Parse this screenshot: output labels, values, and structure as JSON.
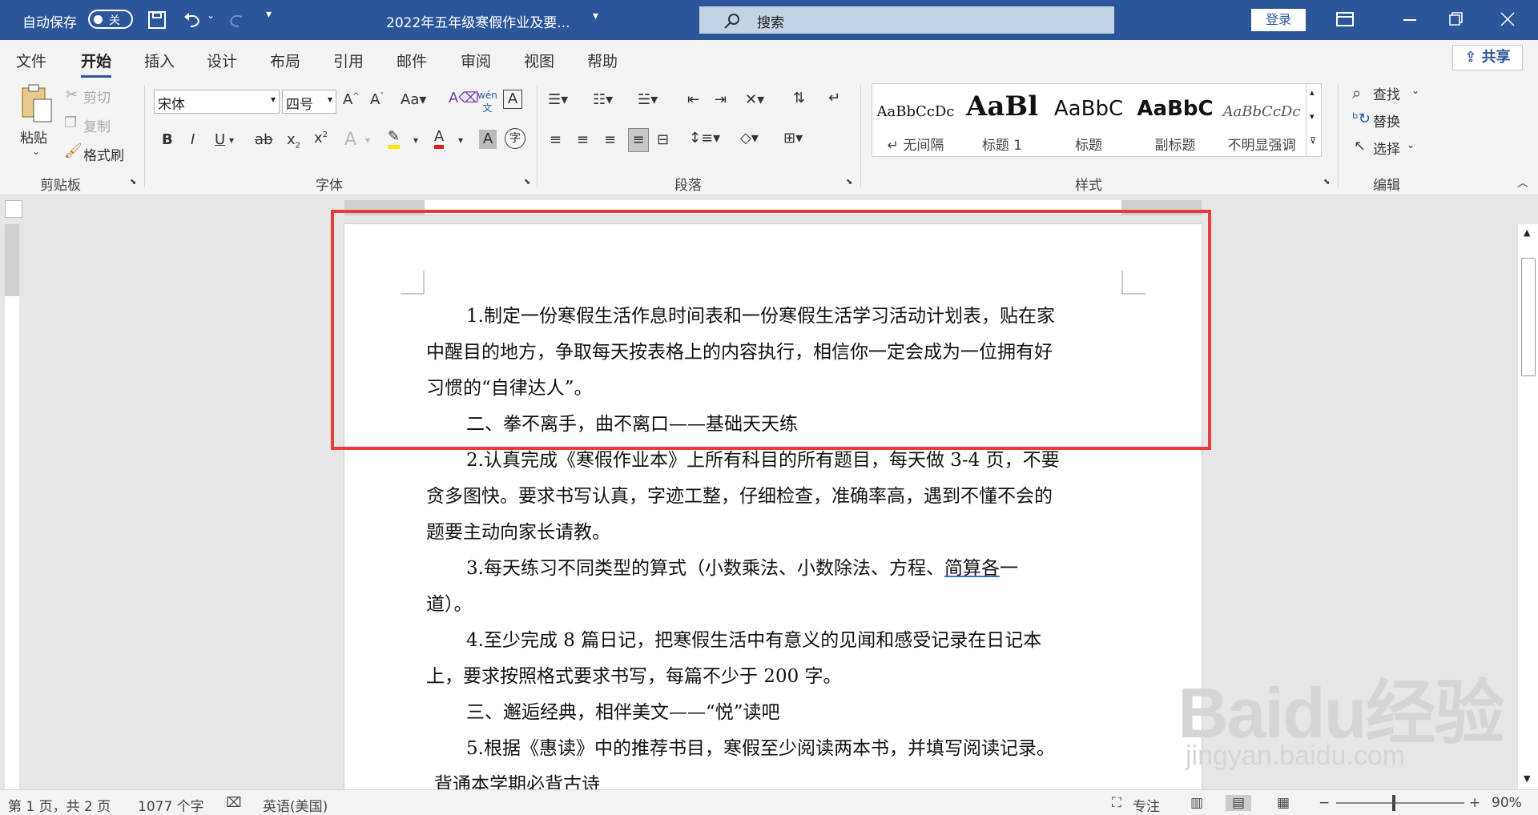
{
  "titlebar": {
    "autosave_label": "自动保存",
    "autosave_state": "关",
    "doc_title": "2022年五年级寒假作业及要...",
    "search_placeholder": "搜索",
    "login": "登录"
  },
  "menu": {
    "tabs": [
      "文件",
      "开始",
      "插入",
      "设计",
      "布局",
      "引用",
      "邮件",
      "审阅",
      "视图",
      "帮助"
    ],
    "active": "开始",
    "share": "共享"
  },
  "ribbon": {
    "clipboard": {
      "paste": "粘贴",
      "cut": "剪切",
      "copy": "复制",
      "format_painter": "格式刷",
      "label": "剪贴板"
    },
    "font": {
      "name": "宋体",
      "size": "四号",
      "label": "字体"
    },
    "paragraph": {
      "label": "段落"
    },
    "styles": {
      "label": "样式",
      "items": [
        {
          "preview": "AaBbCcDc",
          "name": "↵ 无间隔"
        },
        {
          "preview": "AaBl",
          "name": "标题 1"
        },
        {
          "preview": "AaBbC",
          "name": "标题"
        },
        {
          "preview": "AaBbC",
          "name": "副标题"
        },
        {
          "preview": "AaBbCcDc",
          "name": "不明显强调"
        }
      ]
    },
    "editing": {
      "find": "查找",
      "replace": "替换",
      "select": "选择",
      "label": "编辑"
    }
  },
  "document": {
    "paragraphs": [
      "1.制定一份寒假生活作息时间表和一份寒假生活学习活动计划表，贴在家",
      "中醒目的地方，争取每天按表格上的内容执行，相信你一定会成为一位拥有好",
      "习惯的“自律达人”。",
      "二、拳不离手，曲不离口——基础天天练",
      "2.认真完成《寒假作业本》上所有科目的所有题目，每天做 3-4 页，不要",
      "贪多图快。要求书写认真，字迹工整，仔细检查，准确率高，遇到不懂不会的",
      "题要主动向家长请教。",
      "3.每天练习不同类型的算式（小数乘法、小数除法、方程、",
      "简算各",
      "一",
      "道）。",
      "4.至少完成 8 篇日记，把寒假生活中有意义的见闻和感受记录在日记本",
      "上，要求按照格式要求书写，每篇不少于 200 字。",
      "三、邂逅经典，相伴美文——“悦”读吧",
      "5.根据《惠读》中的推荐书目，寒假至少阅读两本书，并填写阅读记录。",
      "背通本学期必背古诗"
    ]
  },
  "statusbar": {
    "page": "第 1 页，共 2 页",
    "words": "1077 个字",
    "language": "英语(美国)",
    "focus": "专注",
    "zoom": "90%"
  },
  "watermark": {
    "brand": "Baidu经验",
    "url": "jingyan.baidu.com"
  }
}
